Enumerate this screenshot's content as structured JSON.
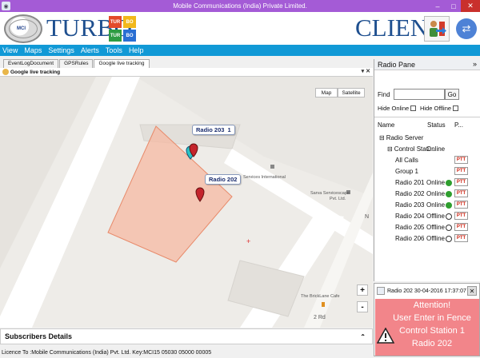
{
  "window": {
    "title": "Mobile Communications (India) Private Limited.",
    "minimize": "–",
    "maximize": "□",
    "close": "✕"
  },
  "header": {
    "brand": "TURBO",
    "client_label": "CLIENT",
    "logo_text": "MCI",
    "turbo_logo": [
      "TUR",
      "BO",
      "TUR",
      "BO"
    ]
  },
  "menu": [
    "View",
    "Maps",
    "Settings",
    "Alerts",
    "Tools",
    "Help"
  ],
  "tabs": [
    "EventLogDocument",
    "GPSRules",
    "Google live tracking"
  ],
  "document": {
    "title": "Google live tracking",
    "controls": "▾ ✕"
  },
  "map": {
    "map_btn": "Map",
    "satellite_btn": "Satellite",
    "zoom_in": "+",
    "zoom_out": "-",
    "pois": {
      "services": "Services International",
      "sarva": "Sarva Servicescape",
      "sarva2": "Pvt. Ltd.",
      "cafe": "The BrickLane Cafe",
      "road": "2 Rd",
      "road2": "N"
    },
    "radio_203_label": "Radio 203",
    "radio_202_label": "Radio 202",
    "radio_203_badge_suffix": "1"
  },
  "subscribers": {
    "title": "Subscribers Details",
    "chevron": "⌃"
  },
  "status_bar": "Licence To :Mobile Communications (India) Pvt. Ltd.   Key:MCI15 05030 05000 00005",
  "radio_pane": {
    "title": "Radio Pane",
    "pin": "»",
    "find_label": "Find",
    "go_label": "Go",
    "hide_online": "Hide Online",
    "hide_offline": "Hide Offline",
    "columns": {
      "name": "Name",
      "status": "Status",
      "p": "P..."
    },
    "rows": [
      {
        "name": "Radio Server",
        "status": "",
        "indent": 0,
        "prefix": "⊟",
        "indicator": "",
        "ptt": false
      },
      {
        "name": "Control Stati...",
        "status": "Online",
        "indent": 1,
        "prefix": "⊟",
        "indicator": "",
        "ptt": false
      },
      {
        "name": "All Calls",
        "status": "",
        "indent": 2,
        "prefix": "",
        "indicator": "",
        "ptt": true
      },
      {
        "name": "Group 1",
        "status": "",
        "indent": 2,
        "prefix": "",
        "indicator": "",
        "ptt": true
      },
      {
        "name": "Radio 201",
        "status": "Online",
        "indent": 2,
        "prefix": "",
        "indicator": "online",
        "ptt": true
      },
      {
        "name": "Radio 202",
        "status": "Online",
        "indent": 2,
        "prefix": "",
        "indicator": "online",
        "ptt": true
      },
      {
        "name": "Radio 203",
        "status": "Online",
        "indent": 2,
        "prefix": "",
        "indicator": "online",
        "ptt": true
      },
      {
        "name": "Radio 204",
        "status": "Offline",
        "indent": 2,
        "prefix": "",
        "indicator": "offline",
        "ptt": true
      },
      {
        "name": "Radio 205",
        "status": "Offline",
        "indent": 2,
        "prefix": "",
        "indicator": "offline",
        "ptt": true
      },
      {
        "name": "Radio 206",
        "status": "Offline",
        "indent": 2,
        "prefix": "",
        "indicator": "offline",
        "ptt": true
      }
    ],
    "ptt_label": "PTT"
  },
  "notification": {
    "header": "Radio 202 30-04-2016 17:37:07",
    "close": "✕",
    "lines": [
      "Attention!",
      "User Enter in Fence",
      "Control Station 1",
      "Radio 202"
    ]
  },
  "colors": {
    "title_bar": "#a45bd6",
    "menu_bar": "#1199d6",
    "brand": "#1e4f8f",
    "alert_bg": "#f2858a",
    "fence_fill": "#f6b9a3",
    "online": "#2e9e2e",
    "offline": "#333333"
  }
}
